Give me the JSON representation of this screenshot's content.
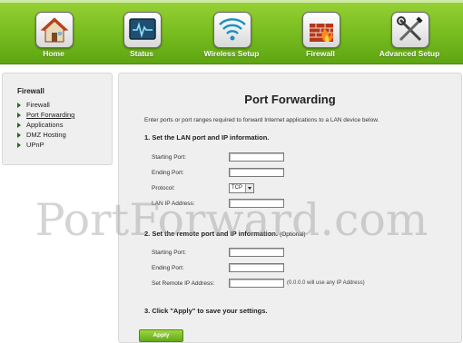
{
  "nav": {
    "items": [
      {
        "label": "Home",
        "icon": "home-icon"
      },
      {
        "label": "Status",
        "icon": "status-monitor-icon"
      },
      {
        "label": "Wireless Setup",
        "icon": "wifi-icon"
      },
      {
        "label": "Firewall",
        "icon": "firewall-icon"
      },
      {
        "label": "Advanced Setup",
        "icon": "tools-icon"
      }
    ],
    "colors": {
      "bar": "#76bb1e",
      "accent_green": "#2a6a18"
    }
  },
  "sidebar": {
    "title": "Firewall",
    "items": [
      {
        "label": "Firewall"
      },
      {
        "label": "Port Forwarding",
        "active": true
      },
      {
        "label": "Applications"
      },
      {
        "label": "DMZ Hosting"
      },
      {
        "label": "UPnP"
      }
    ]
  },
  "main": {
    "title": "Port Forwarding",
    "intro": "Enter ports or port ranges required to forward Internet applications to a LAN device below.",
    "section1": {
      "heading": "1. Set the LAN port and IP information.",
      "starting_port_label": "Starting Port:",
      "starting_port_value": "",
      "ending_port_label": "Ending Port:",
      "ending_port_value": "",
      "protocol_label": "Protocol:",
      "protocol_value": "TCP",
      "lan_ip_label": "LAN IP Address:",
      "lan_ip_value": ""
    },
    "section2": {
      "heading": "2. Set the remote port and IP information.",
      "optional": "(Optional)",
      "starting_port_label": "Starting Port:",
      "starting_port_value": "",
      "ending_port_label": "Ending Port:",
      "ending_port_value": "",
      "remote_ip_label": "Set Remote IP Address:",
      "remote_ip_value": "",
      "remote_ip_hint": "(0.0.0.0 will use any IP Address)"
    },
    "section3": {
      "heading": "3. Click \"Apply\" to save your settings."
    },
    "apply_label": "Apply"
  },
  "watermark": "PortForward.com"
}
